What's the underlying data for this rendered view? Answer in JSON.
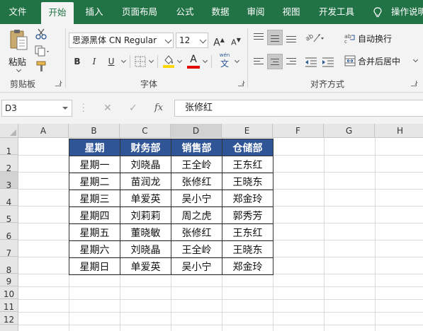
{
  "ribbon": {
    "tabs": [
      "文件",
      "开始",
      "插入",
      "页面布局",
      "公式",
      "数据",
      "审阅",
      "视图",
      "开发工具"
    ],
    "active_tab": "开始",
    "tell_me": "操作说明",
    "clipboard": {
      "paste": "粘贴",
      "group_label": "剪贴板"
    },
    "font": {
      "name": "思源黑体 CN Regular",
      "size": "12",
      "bold": "B",
      "italic": "I",
      "underline": "U",
      "font_color_label": "A",
      "phonetic_label": "wén",
      "phonetic_char": "文",
      "group_label": "字体"
    },
    "alignment": {
      "wrap_text": "自动换行",
      "merge_center": "合并后居中",
      "group_label": "对齐方式"
    }
  },
  "formula_bar": {
    "name_box": "D3",
    "fx": "fx",
    "value": "张修红"
  },
  "sheet": {
    "columns": [
      "A",
      "B",
      "C",
      "D",
      "E",
      "F",
      "G",
      "H"
    ],
    "rows": [
      "1",
      "2",
      "3",
      "4",
      "5",
      "6",
      "7",
      "8",
      "9",
      "10",
      "11",
      "12"
    ],
    "table_headers": [
      "星期",
      "财务部",
      "销售部",
      "仓储部"
    ],
    "table_rows": [
      [
        "星期一",
        "刘晓晶",
        "王全岭",
        "王东红"
      ],
      [
        "星期二",
        "苗润龙",
        "张修红",
        "王晓东"
      ],
      [
        "星期三",
        "单爱英",
        "吴小宁",
        "郑金玲"
      ],
      [
        "星期四",
        "刘莉莉",
        "周之虎",
        "郭秀芳"
      ],
      [
        "星期五",
        "董晓敏",
        "张修红",
        "王东红"
      ],
      [
        "星期六",
        "刘晓晶",
        "王全岭",
        "王晓东"
      ],
      [
        "星期日",
        "单爱英",
        "吴小宁",
        "郑金玲"
      ]
    ]
  },
  "colors": {
    "ribbon_green": "#217346",
    "header_fill": "#2f5597",
    "font_color_bar": "#e00000",
    "fill_color_bar": "#ffd700"
  }
}
